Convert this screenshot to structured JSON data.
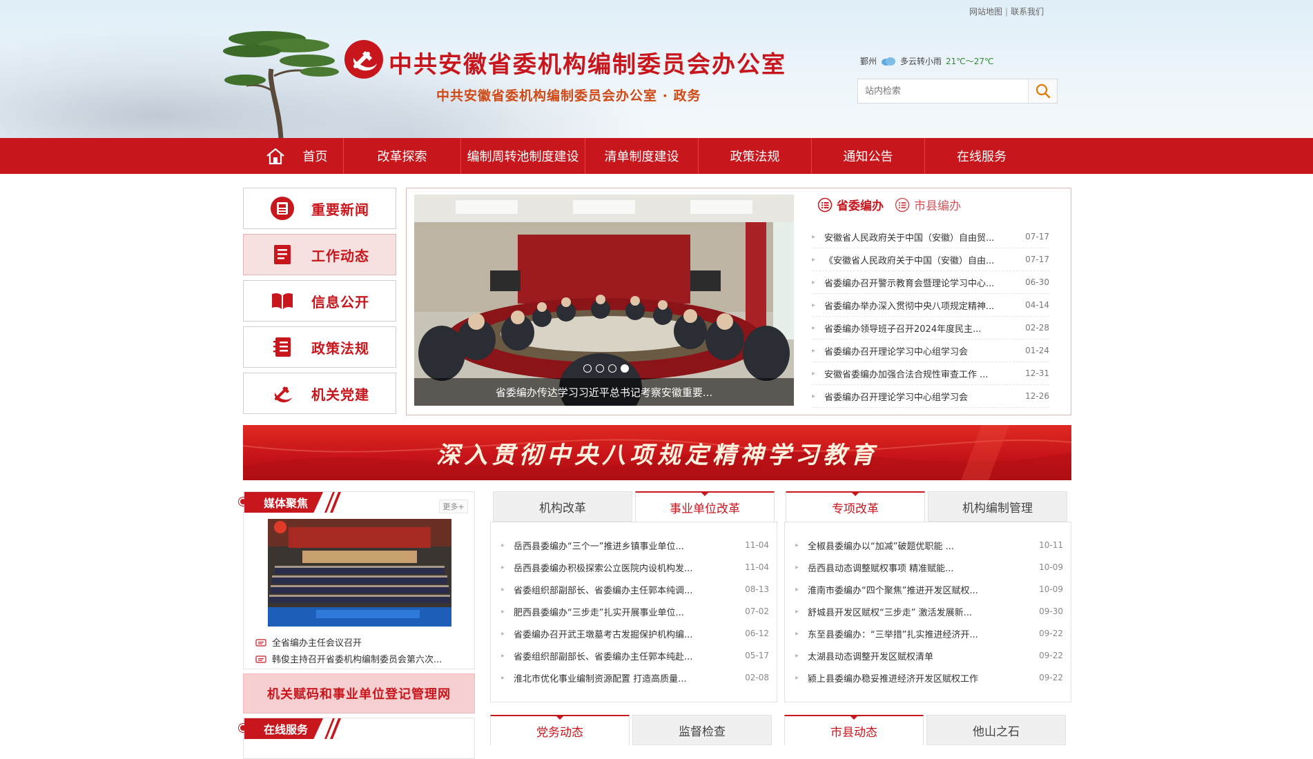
{
  "header": {
    "title": "中共安徽省委机构编制委员会办公室",
    "subtitle": "中共安徽省委机构编制委员会办公室 · 政务",
    "top_links": [
      "网站地图",
      "联系我们"
    ],
    "weather": {
      "city": "鄞州",
      "condition": "多云转小雨",
      "temp": "21℃～27℃"
    },
    "search_placeholder": "站内检索"
  },
  "nav": {
    "items": [
      "首页",
      "改革探索",
      "编制周转池制度建设",
      "清单制度建设",
      "政策法规",
      "通知公告",
      "在线服务"
    ]
  },
  "categories": [
    "重要新闻",
    "工作动态",
    "信息公开",
    "政策法规",
    "机关党建"
  ],
  "slider": {
    "caption": "省委编办传达学习习近平总书记考察安徽重要...",
    "dot_count": 4,
    "active_dot": 3
  },
  "top_tabs": [
    "省委编办",
    "市县编办"
  ],
  "top_news": [
    {
      "title": "安徽省人民政府关于中国（安徽）自由贸...",
      "date": "07-17"
    },
    {
      "title": "《安徽省人民政府关于中国（安徽）自由...",
      "date": "07-17"
    },
    {
      "title": "省委编办召开警示教育会暨理论学习中心...",
      "date": "06-30"
    },
    {
      "title": "省委编办举办深入贯彻中央八项规定精神...",
      "date": "04-14"
    },
    {
      "title": "省委编办领导班子召开2024年度民主...",
      "date": "02-28"
    },
    {
      "title": "省委编办召开理论学习中心组学习会",
      "date": "01-24"
    },
    {
      "title": "安徽省委编办加强合法合规性审查工作 ...",
      "date": "12-31"
    },
    {
      "title": "省委编办召开理论学习中心组学习会",
      "date": "12-26"
    }
  ],
  "banner": "深入贯彻中央八项规定精神学习教育",
  "media": {
    "title": "媒体聚焦",
    "more": "更多+",
    "items": [
      "全省编办主任会议召开",
      "韩俊主持召开省委机构编制委员会第六次..."
    ]
  },
  "register_link": "机关赋码和事业单位登记管理网",
  "online_service": "在线服务",
  "panel1": {
    "tabs": [
      "机构改革",
      "事业单位改革"
    ],
    "active": 1,
    "items": [
      {
        "title": "岳西县委编办“三个一”推进乡镇事业单位...",
        "date": "11-04"
      },
      {
        "title": "岳西县委编办积极探索公立医院内设机构发...",
        "date": "11-04"
      },
      {
        "title": "省委组织部副部长、省委编办主任郭本纯调...",
        "date": "08-13"
      },
      {
        "title": "肥西县委编办“三步走”扎实开展事业单位...",
        "date": "07-02"
      },
      {
        "title": "省委编办召开武王墩墓考古发掘保护机构编...",
        "date": "06-12"
      },
      {
        "title": "省委组织部副部长、省委编办主任郭本纯赴...",
        "date": "05-17"
      },
      {
        "title": "淮北市优化事业编制资源配置 打造高质量...",
        "date": "02-08"
      }
    ]
  },
  "panel2": {
    "tabs": [
      "专项改革",
      "机构编制管理"
    ],
    "active": 0,
    "items": [
      {
        "title": "全椒县委编办以“加减”破题优职能 ...",
        "date": "10-11"
      },
      {
        "title": "岳西县动态调整赋权事项 精准赋能...",
        "date": "10-09"
      },
      {
        "title": "淮南市委编办“四个聚焦”推进开发区赋权...",
        "date": "10-09"
      },
      {
        "title": "舒城县开发区赋权“三步走” 激活发展新...",
        "date": "09-30"
      },
      {
        "title": "东至县委编办：“三举措”扎实推进经济开...",
        "date": "09-22"
      },
      {
        "title": "太湖县动态调整开发区赋权清单",
        "date": "09-22"
      },
      {
        "title": "颍上县委编办稳妥推进经济开发区赋权工作",
        "date": "09-22"
      }
    ]
  },
  "panel3": {
    "tabs": [
      "党务动态",
      "监督检查"
    ],
    "active": 0
  },
  "panel4": {
    "tabs": [
      "市县动态",
      "他山之石"
    ],
    "active": 0
  },
  "colors": {
    "primary": "#c8161d",
    "accent_orange": "#d04a15",
    "active_bg": "#f7e0e0"
  }
}
